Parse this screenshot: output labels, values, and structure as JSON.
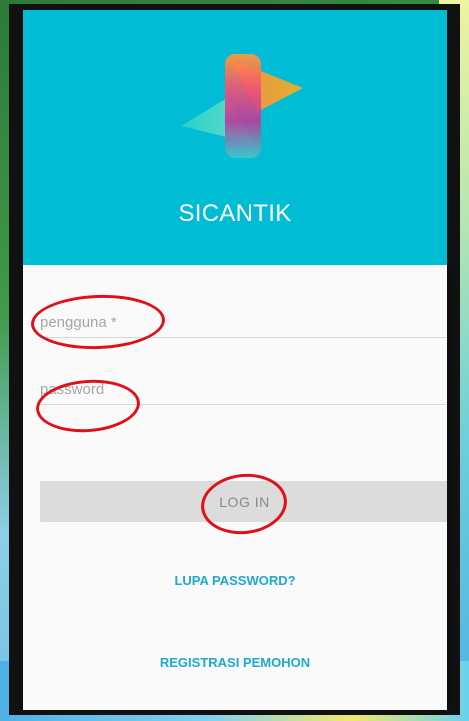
{
  "app": {
    "title": "SICANTIK"
  },
  "form": {
    "username_placeholder": "pengguna *",
    "username_value": "",
    "password_placeholder": "password",
    "password_value": "",
    "login_label": "LOG IN"
  },
  "links": {
    "forgot_password": "LUPA PASSWORD?",
    "register": "REGISTRASI PEMOHON"
  },
  "colors": {
    "header": "#00bcd4",
    "card_background": "#fafafa",
    "link": "#1fa9cf",
    "button_background": "#dcdcdc",
    "annotation": "#e0101a"
  },
  "icons": {
    "logo": "sicantik-logo-icon"
  }
}
